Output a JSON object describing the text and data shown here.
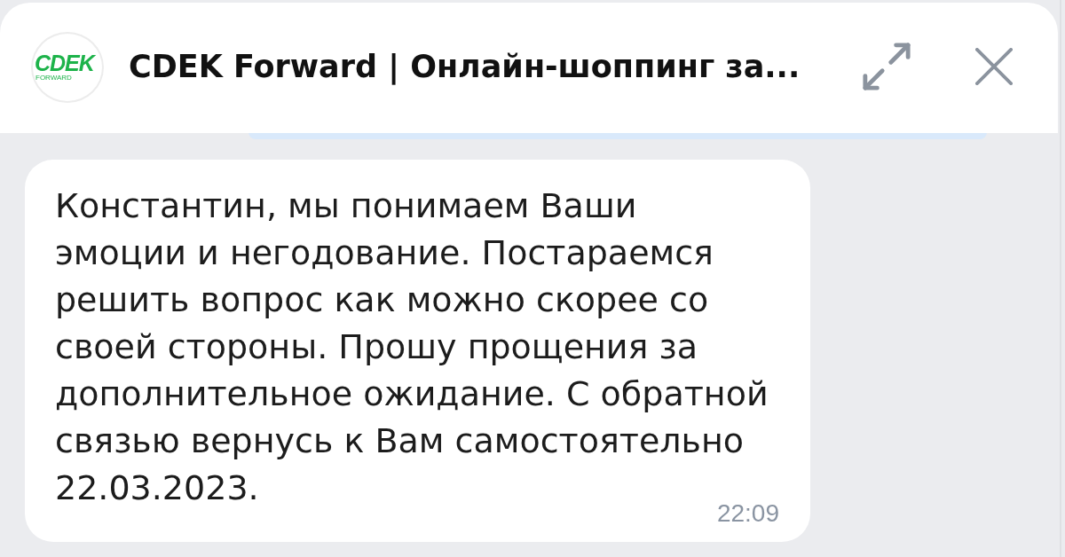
{
  "chat_header": {
    "logo": {
      "wordmark": "CDEK",
      "tagline": "FORWARD"
    },
    "title": "CDEK Forward | Онлайн-шоппинг за..."
  },
  "messages": [
    {
      "text": "Константин, мы понимаем Ваши\nэмоции и негодование. Постараемся\nрешить вопрос как можно скорее со\nсвоей стороны. Прошу прощения за\nдополнительное ожидание. С обратной\nсвязью вернусь к Вам самостоятельно\n22.03.2023.",
      "time": "22:09"
    }
  ]
}
